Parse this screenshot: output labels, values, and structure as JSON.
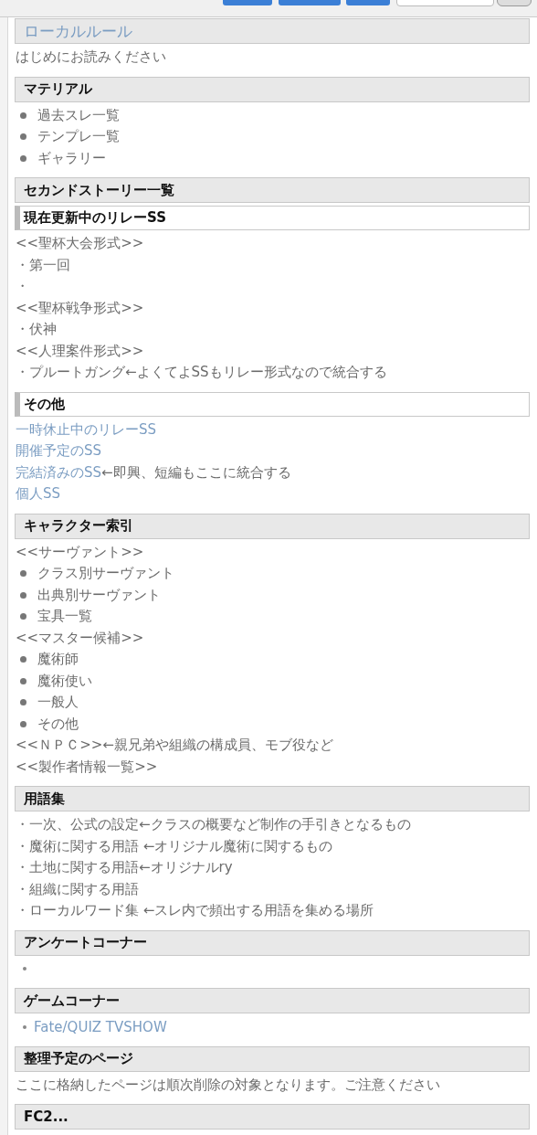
{
  "sections": [
    {
      "heading": {
        "kind": "link",
        "text": "ローカルルール"
      },
      "lines": [
        {
          "kind": "text",
          "text": "はじめにお読みください"
        }
      ]
    },
    {
      "heading": {
        "kind": "box",
        "text": "マテリアル"
      },
      "lines": [
        {
          "kind": "bullet",
          "text": "過去スレ一覧"
        },
        {
          "kind": "bullet",
          "text": "テンプレ一覧"
        },
        {
          "kind": "bullet",
          "text": "ギャラリー"
        }
      ]
    },
    {
      "heading": {
        "kind": "box",
        "text": "セカンドストーリー一覧"
      }
    },
    {
      "heading": {
        "kind": "sub",
        "text": "現在更新中のリレーSS"
      },
      "lines": [
        {
          "kind": "text",
          "text": "<<聖杯大会形式>>"
        },
        {
          "kind": "text",
          "text": "・第一回"
        },
        {
          "kind": "text",
          "text": "・"
        },
        {
          "kind": "text",
          "text": "<<聖杯戦争形式>>"
        },
        {
          "kind": "text",
          "text": "・伏神"
        },
        {
          "kind": "text",
          "text": "<<人理案件形式>>"
        },
        {
          "kind": "text",
          "text": "・プルートガング←よくてよSSもリレー形式なので統合する"
        }
      ]
    },
    {
      "heading": {
        "kind": "sub",
        "text": "その他"
      },
      "lines": [
        {
          "kind": "link",
          "text": "一時休止中のリレーSS"
        },
        {
          "kind": "link",
          "text": "開催予定のSS"
        },
        {
          "kind": "link",
          "text": "完結済みのSS",
          "note": "←即興、短編もここに統合する"
        },
        {
          "kind": "link",
          "text": "個人SS"
        }
      ]
    },
    {
      "heading": {
        "kind": "box",
        "text": "キャラクター索引"
      },
      "lines": [
        {
          "kind": "text",
          "text": "<<サーヴァント>>"
        },
        {
          "kind": "bullet",
          "text": "クラス別サーヴァント"
        },
        {
          "kind": "bullet",
          "text": "出典別サーヴァント"
        },
        {
          "kind": "bullet",
          "text": "宝具一覧"
        },
        {
          "kind": "text",
          "text": "<<マスター候補>>"
        },
        {
          "kind": "bullet",
          "text": "魔術師"
        },
        {
          "kind": "bullet",
          "text": "魔術使い"
        },
        {
          "kind": "bullet",
          "text": "一般人"
        },
        {
          "kind": "bullet",
          "text": "その他"
        },
        {
          "kind": "text",
          "text": "<<ＮＰＣ>>←親兄弟や組織の構成員、モブ役など"
        },
        {
          "kind": "text",
          "text": "<<製作者情報一覧>>"
        }
      ]
    },
    {
      "heading": {
        "kind": "box",
        "text": "用語集"
      },
      "lines": [
        {
          "kind": "text",
          "text": "・一次、公式の設定←クラスの概要など制作の手引きとなるもの"
        },
        {
          "kind": "text",
          "text": "・魔術に関する用語 ←オリジナル魔術に関するもの"
        },
        {
          "kind": "text",
          "text": "・土地に関する用語←オリジナルry"
        },
        {
          "kind": "text",
          "text": "・組織に関する用語"
        },
        {
          "kind": "text",
          "text": "・ローカルワード集 ←スレ内で頻出する用語を集める場所"
        }
      ]
    },
    {
      "heading": {
        "kind": "box",
        "text": "アンケートコーナー"
      },
      "lines": [
        {
          "kind": "dot"
        }
      ]
    },
    {
      "heading": {
        "kind": "box",
        "text": "ゲームコーナー"
      },
      "lines": [
        {
          "kind": "dot-link",
          "text": "Fate/QUIZ TVSHOW"
        }
      ]
    },
    {
      "heading": {
        "kind": "box",
        "text": "整理予定のページ"
      },
      "lines": [
        {
          "kind": "text",
          "text": "ここに格納したページは順次削除の対象となります。ご注意ください"
        }
      ]
    },
    {
      "heading": {
        "kind": "box",
        "text": "FC2..."
      }
    }
  ]
}
